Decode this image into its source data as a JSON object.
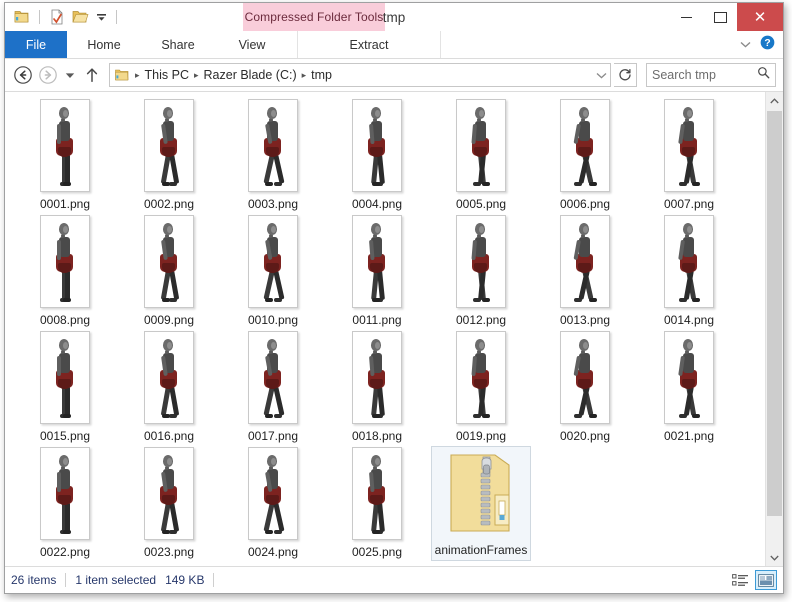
{
  "window": {
    "title": "tmp",
    "contextual_tab_banner": "Compressed Folder Tools",
    "controls": {
      "minimize": "minimize-button",
      "maximize": "maximize-button",
      "close": "✕"
    },
    "colors": {
      "file_tab_blue": "#1e71c8",
      "close_red": "#cc4b4c",
      "contextual_pink": "#f9cdda",
      "selection_blue": "#f2f6fa",
      "status_text": "#27386b"
    }
  },
  "quick_access": {
    "items": [
      {
        "name": "folder-icon",
        "label": "Folder"
      },
      {
        "name": "properties-icon",
        "label": "Properties"
      },
      {
        "name": "new-folder-icon",
        "label": "New folder"
      },
      {
        "name": "customize-dropdown-icon",
        "label": "Customize Quick Access Toolbar"
      }
    ]
  },
  "ribbon": {
    "tabs": [
      {
        "id": "file",
        "label": "File"
      },
      {
        "id": "home",
        "label": "Home"
      },
      {
        "id": "share",
        "label": "Share"
      },
      {
        "id": "view",
        "label": "View"
      },
      {
        "id": "extract",
        "label": "Extract"
      }
    ],
    "collapse_label": "Minimize the Ribbon",
    "help_label": "Help"
  },
  "address": {
    "back": "Back",
    "forward": "Forward",
    "recent": "Recent locations",
    "up": "Up",
    "breadcrumbs": [
      "This PC",
      "Razer Blade (C:)",
      "tmp"
    ],
    "separator": "▸",
    "dropdown": "Previous locations",
    "refresh": "Refresh",
    "search_placeholder": "Search tmp"
  },
  "files": [
    {
      "name": "0001.png",
      "type": "image",
      "selected": false
    },
    {
      "name": "0002.png",
      "type": "image",
      "selected": false
    },
    {
      "name": "0003.png",
      "type": "image",
      "selected": false
    },
    {
      "name": "0004.png",
      "type": "image",
      "selected": false
    },
    {
      "name": "0005.png",
      "type": "image",
      "selected": false
    },
    {
      "name": "0006.png",
      "type": "image",
      "selected": false
    },
    {
      "name": "0007.png",
      "type": "image",
      "selected": false
    },
    {
      "name": "0008.png",
      "type": "image",
      "selected": false
    },
    {
      "name": "0009.png",
      "type": "image",
      "selected": false
    },
    {
      "name": "0010.png",
      "type": "image",
      "selected": false
    },
    {
      "name": "0011.png",
      "type": "image",
      "selected": false
    },
    {
      "name": "0012.png",
      "type": "image",
      "selected": false
    },
    {
      "name": "0013.png",
      "type": "image",
      "selected": false
    },
    {
      "name": "0014.png",
      "type": "image",
      "selected": false
    },
    {
      "name": "0015.png",
      "type": "image",
      "selected": false
    },
    {
      "name": "0016.png",
      "type": "image",
      "selected": false
    },
    {
      "name": "0017.png",
      "type": "image",
      "selected": false
    },
    {
      "name": "0018.png",
      "type": "image",
      "selected": false
    },
    {
      "name": "0019.png",
      "type": "image",
      "selected": false
    },
    {
      "name": "0020.png",
      "type": "image",
      "selected": false
    },
    {
      "name": "0021.png",
      "type": "image",
      "selected": false
    },
    {
      "name": "0022.png",
      "type": "image",
      "selected": false
    },
    {
      "name": "0023.png",
      "type": "image",
      "selected": false
    },
    {
      "name": "0024.png",
      "type": "image",
      "selected": false
    },
    {
      "name": "0025.png",
      "type": "image",
      "selected": false
    },
    {
      "name": "animationFrames",
      "type": "zip-folder",
      "selected": true
    }
  ],
  "status": {
    "item_count": "26 items",
    "selection": "1 item selected",
    "size": "149 KB"
  },
  "view_buttons": {
    "details": "Details view",
    "large_icons": "Large icons view",
    "active": "large_icons"
  }
}
